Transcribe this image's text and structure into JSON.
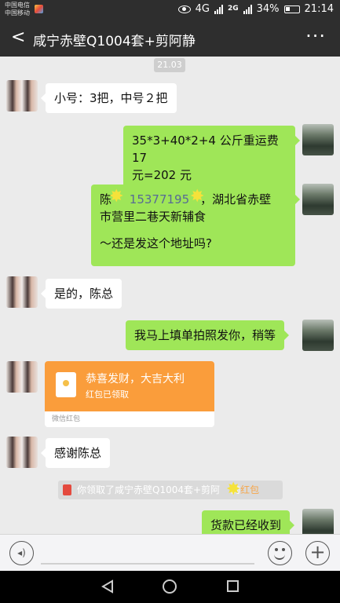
{
  "status": {
    "carrier1": "中国电信",
    "carrier2": "中国移动",
    "network": "4G",
    "network2": "2G",
    "battery": "34%",
    "time": "21:14"
  },
  "header": {
    "back": "<",
    "title": "咸宁赤壁Q1004套+剪阿静",
    "more": "···"
  },
  "chat": {
    "time_marker": "21.03",
    "messages": [
      {
        "text": "小号：3把，中号２把"
      },
      {
        "line1": "35*3+40*2+4 公斤重运费 17",
        "line2": "元=202 元"
      },
      {
        "prefix": "陈",
        "phone": "15377195",
        "line1_rest": "，湖北省赤壁",
        "line2": "市营里二巷天新辅食",
        "line3": "～还是发这个地址吗?"
      },
      {
        "text": "是的，陈总"
      },
      {
        "text": "我马上填单拍照发你，稍等"
      },
      {
        "rp_title": "恭喜发财，大吉大利",
        "rp_status": "红包已领取",
        "rp_source": "微信红包"
      },
      {
        "text": "感谢陈总"
      },
      {
        "sys_text": "你领取了咸宁赤壁Q1004套+剪阿",
        "sys_suffix": "的",
        "sys_link": "红包"
      },
      {
        "text": "货款已经收到"
      }
    ]
  },
  "input": {
    "voice": "◂)",
    "plus": "+"
  }
}
